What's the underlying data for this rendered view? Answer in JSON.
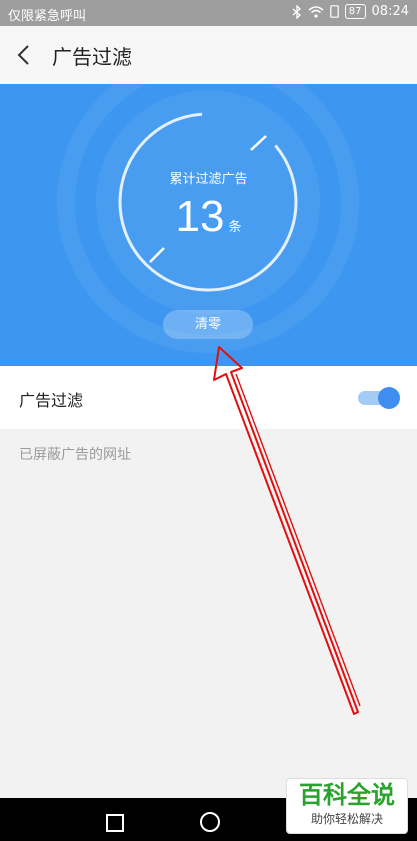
{
  "status_bar": {
    "carrier": "仅限紧急呼叫",
    "battery": "87",
    "time": "08:24"
  },
  "header": {
    "title": "广告过滤"
  },
  "hero": {
    "label": "累计过滤广告",
    "count": "13",
    "unit": "条",
    "clear_button": "清零"
  },
  "setting": {
    "label": "广告过滤",
    "toggle_on": true
  },
  "blocked_section": {
    "label": "已屏蔽广告的网址"
  },
  "watermark": {
    "main": "百科全说",
    "sub": "助你轻松解决"
  },
  "colors": {
    "hero_blue": "#3d97f0",
    "toggle_blue": "#3d8ef0",
    "annotation_red": "#e01010",
    "watermark_green": "#29a32b"
  },
  "icons": [
    "bluetooth-icon",
    "wifi-icon",
    "battery-icon",
    "back-icon",
    "recents-square-icon",
    "home-circle-icon"
  ]
}
